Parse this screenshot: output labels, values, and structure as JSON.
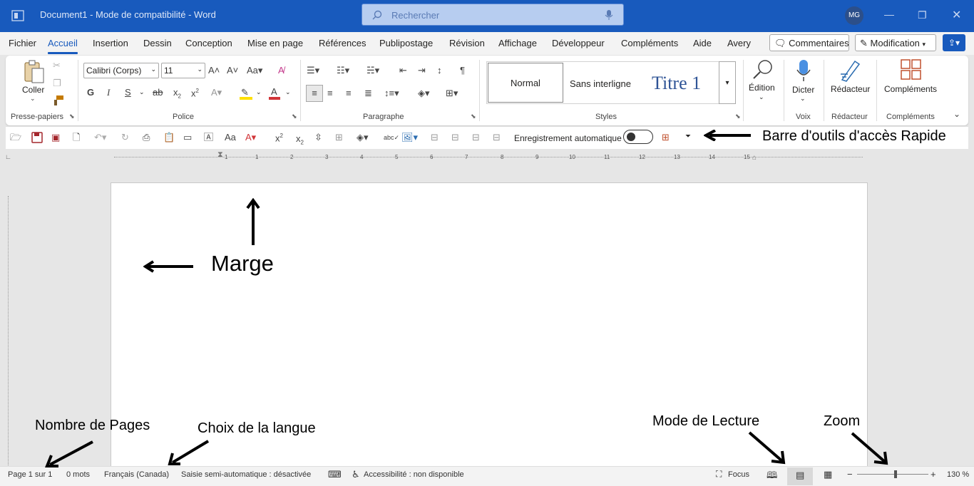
{
  "titlebar": {
    "document": "Document1  -  Mode de compatibilité  -  Word",
    "search_placeholder": "Rechercher",
    "avatar": "MG"
  },
  "tabs": [
    "Fichier",
    "Accueil",
    "Insertion",
    "Dessin",
    "Conception",
    "Mise en page",
    "Références",
    "Publipostage",
    "Révision",
    "Affichage",
    "Développeur",
    "Compléments",
    "Aide",
    "Avery"
  ],
  "active_tab": "Accueil",
  "topbuttons": {
    "comments": "Commentaires",
    "editing": "Modification"
  },
  "clipboard": {
    "paste": "Coller",
    "group": "Presse-papiers"
  },
  "font": {
    "name": "Calibri (Corps)",
    "size": "11",
    "group": "Police",
    "bold": "G",
    "italic": "I",
    "underline": "S",
    "font_color": "#d13438",
    "highlight_color": "#ffe000"
  },
  "paragraph": {
    "group": "Paragraphe"
  },
  "styles": {
    "group": "Styles",
    "items": [
      "Normal",
      "Sans interligne",
      "Titre 1"
    ]
  },
  "edition": {
    "label": "Édition"
  },
  "voice": {
    "label": "Dicter",
    "group": "Voix"
  },
  "editor": {
    "label": "Rédacteur",
    "group": "Rédacteur"
  },
  "addins": {
    "label": "Compléments",
    "group": "Compléments"
  },
  "qat": {
    "autosave": "Enregistrement automatique",
    "autosave_on": false,
    "annotation": "Barre d'outils d'accès Rapide"
  },
  "ruler": {
    "ticks": [
      "1",
      "1",
      "2",
      "3",
      "4",
      "5",
      "6",
      "7",
      "8",
      "9",
      "10",
      "11",
      "12",
      "13",
      "14",
      "15"
    ]
  },
  "page_annotations": {
    "margin": "Marge"
  },
  "status_annotations": {
    "pages": "Nombre de Pages",
    "language": "Choix de la langue",
    "reading": "Mode de Lecture",
    "zoom": "Zoom"
  },
  "statusbar": {
    "page": "Page 1 sur 1",
    "words": "0 mots",
    "language": "Français (Canada)",
    "predict": "Saisie semi-automatique : désactivée",
    "accessibility": "Accessibilité : non disponible",
    "focus": "Focus",
    "zoom": "130 %",
    "zoom_level": 0.54
  }
}
